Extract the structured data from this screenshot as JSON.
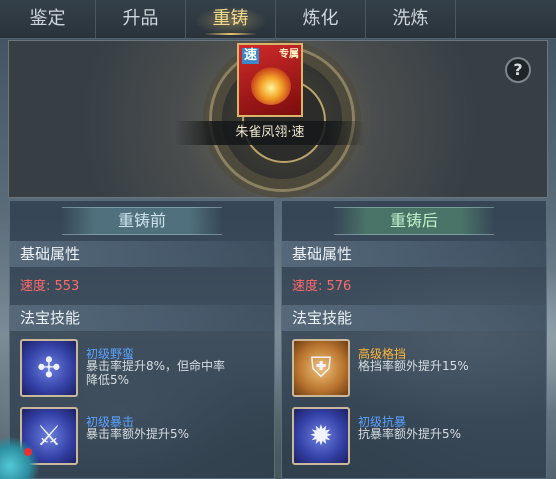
{
  "tabs": [
    "鉴定",
    "升品",
    "重铸",
    "炼化",
    "洗炼"
  ],
  "active_tab": "重铸",
  "item": {
    "name": "朱雀凤翎·速",
    "icon_badge": "速",
    "icon_tag": "专属"
  },
  "help": "?",
  "before": {
    "title": "重铸前",
    "attr_header": "基础属性",
    "stat": "速度: 553",
    "skill_header": "法宝技能",
    "skills": [
      {
        "name": "初级野蛮",
        "desc": "暴击率提升8%，但命中率降低5%",
        "icon": "paw-icon",
        "tier": "blue"
      },
      {
        "name": "初级暴击",
        "desc": "暴击率额外提升5%",
        "icon": "critical-strike-icon",
        "tier": "blue"
      }
    ]
  },
  "after": {
    "title": "重铸后",
    "attr_header": "基础属性",
    "stat": "速度: 576",
    "skill_header": "法宝技能",
    "skills": [
      {
        "name": "高级格挡",
        "desc": "格挡率额外提升15%",
        "icon": "shield-icon",
        "tier": "gold"
      },
      {
        "name": "初级抗暴",
        "desc": "抗暴率额外提升5%",
        "icon": "anti-critical-icon",
        "tier": "blue"
      }
    ]
  },
  "colors": {
    "active_tab": "#f3d98a",
    "stat_value": "#ff6a6a",
    "skill_blue": "#5aa2ff",
    "skill_gold": "#ffb637"
  }
}
